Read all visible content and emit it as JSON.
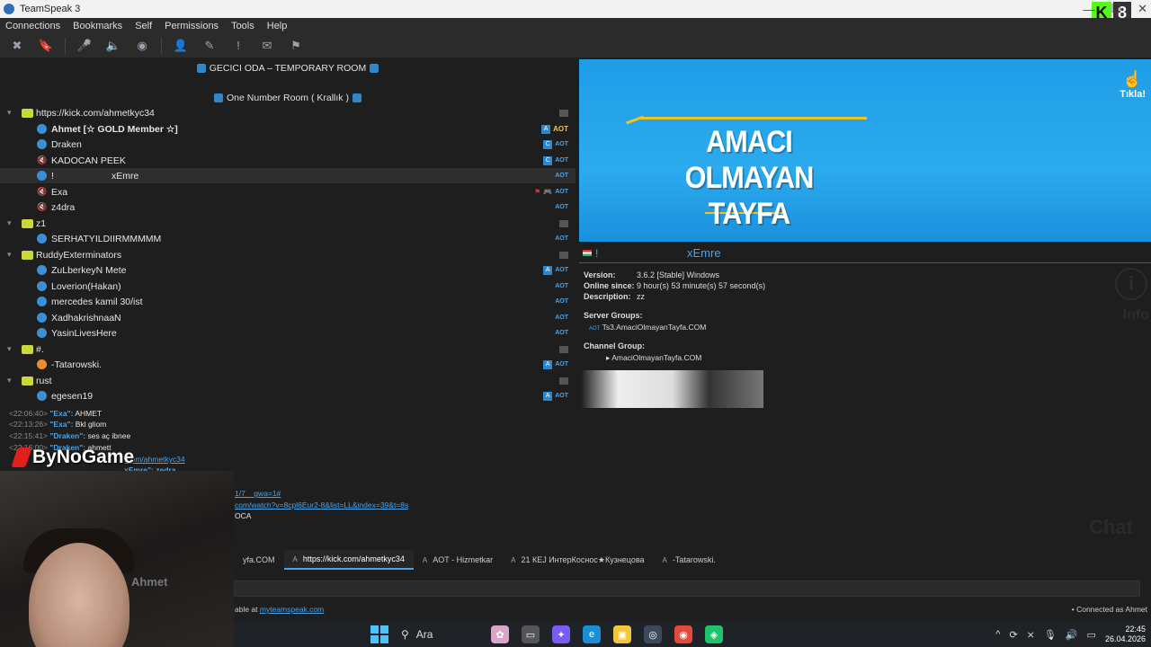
{
  "window": {
    "title": "TeamSpeak 3",
    "minimize": "—",
    "maximize": "☐",
    "close": "✕",
    "brand_k": "K",
    "brand_n": "8"
  },
  "menu": [
    "Connections",
    "Bookmarks",
    "Self",
    "Permissions",
    "Tools",
    "Help"
  ],
  "tree": {
    "spacer_top": "GECICI ODA – TEMPORARY ROOM",
    "spacer_room": "One Number Room ( Krallık )",
    "channels": [
      {
        "name": "https://kick.com/ahmetkyc34"
      },
      {
        "name": "z1"
      },
      {
        "name": "RuddyExterminators"
      },
      {
        "name": "#."
      },
      {
        "name": "rust"
      }
    ],
    "users": [
      {
        "name": "Ahmet [☆ GOLD Member ☆]"
      },
      {
        "name": "Draken"
      },
      {
        "name": "KADOCAN PEEK"
      },
      {
        "name": "!",
        "suffix": "xEmre"
      },
      {
        "name": "Exa"
      },
      {
        "name": "z4dra"
      },
      {
        "name": "SERHATYILDIIRMMMMM"
      },
      {
        "name": "ZuLberkeyN Mete"
      },
      {
        "name": "Loverion(Hakan)"
      },
      {
        "name": "mercedes kamil 30/ist"
      },
      {
        "name": "XadhakrishnaaN"
      },
      {
        "name": "YasinLivesHere"
      },
      {
        "name": "-Tatarowski."
      },
      {
        "name": "egesen19"
      }
    ],
    "badge_aot": "AOT",
    "badge_a": "A",
    "badge_c": "C"
  },
  "info": {
    "banner_line1": "AMACI OLMAYAN",
    "banner_line2": "TAYFA",
    "tikla": "Tıkla!",
    "nick_prefix": "!",
    "nick": "xEmre",
    "version_label": "Version:",
    "version": "3.6.2 [Stable] Windows",
    "online_label": "Online since:",
    "online": "9 hour(s) 53 minute(s) 57 second(s)",
    "desc_label": "Description:",
    "desc": "zz",
    "server_groups_label": "Server Groups:",
    "server_group": "Ts3.AmaciOlmayanTayfa.COM",
    "server_group_tag": "AOT",
    "channel_group_label": "Channel Group:",
    "channel_group": "AmaciOlmayanTayfa.COM",
    "info_icon": "i",
    "info_word": "Info"
  },
  "chat": {
    "messages": [
      {
        "ts": "<22:06:40>",
        "who": "\"Exa\":",
        "text": "AHMET"
      },
      {
        "ts": "<22:13:26>",
        "who": "\"Exa\":",
        "text": "Bkl gliom"
      },
      {
        "ts": "<22:15:41>",
        "who": "\"Draken\":",
        "text": "ses aç ibnee"
      },
      {
        "ts": "<22:16:00>",
        "who": "\"Draken\":",
        "text": "ahmett"
      }
    ],
    "link1": ".com/ahmetkyc34",
    "line_xemre": "xEmre\": zedra",
    "link2": "1/7__gwa=1#",
    "link3": "com/watch?v=8cpl6Eur2-8&list=LL&index=39&t=8s",
    "line_oca": "OCA",
    "watermark": "Chat"
  },
  "tabs": [
    {
      "label": "yfa.COM",
      "icon": ""
    },
    {
      "label": "https://kick.com/ahmetkyc34",
      "icon": "A"
    },
    {
      "label": "AOT - Hizmetkar",
      "icon": "A"
    },
    {
      "label": "21 КЕЈ ИнтерКоснос★Кузнецова",
      "icon": "A"
    },
    {
      "label": "-Tatarowski.",
      "icon": "A"
    }
  ],
  "status": {
    "left_prefix": "able at",
    "left_link": "myteamspeak.com",
    "right": "Connected as Ahmet"
  },
  "overlay": {
    "logo": "ByNoGame",
    "webcam_tag": "Ahmet"
  },
  "taskbar": {
    "search": "Ara",
    "time": "22:45",
    "date": "26.04.2026"
  }
}
